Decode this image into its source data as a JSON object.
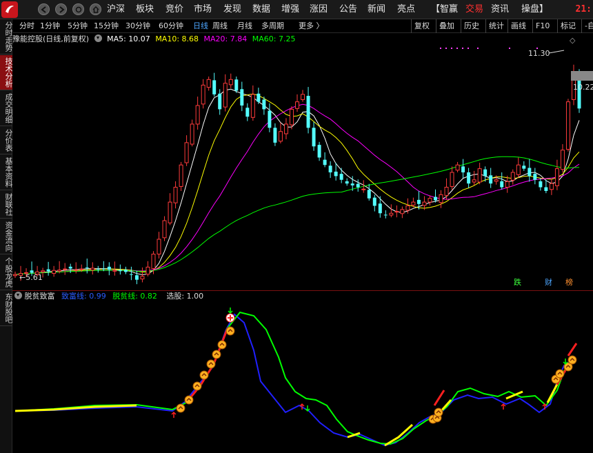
{
  "menu": {
    "items": [
      "沪深",
      "板块",
      "竞价",
      "市场",
      "发现",
      "数据",
      "增强",
      "涨因",
      "公告",
      "新闻",
      "亮点"
    ],
    "bracket_left": "【智赢",
    "trade": "交易",
    "news": "资讯",
    "operate": "操盘】",
    "clock": "21:"
  },
  "left_tabs": [
    "分时走势",
    "技术分析",
    "成交明细",
    "分价表",
    "基本资料",
    "财联社",
    "资金流向",
    "个股龙虎",
    "东财股吧"
  ],
  "left_tabs_active": 1,
  "periods": [
    "分时",
    "1分钟",
    "5分钟",
    "15分钟",
    "30分钟",
    "60分钟",
    "日线",
    "周线",
    "月线",
    "多周期",
    "更多 〉"
  ],
  "periods_active": 6,
  "tools": [
    "复权",
    "叠加",
    "历史",
    "统计",
    "画线",
    "F10",
    "标记",
    "-自"
  ],
  "chart_title": {
    "stock": "豫能控股(日线,前复权)",
    "ma5": "MA5: 10.07",
    "ma10": "MA10: 8.68",
    "ma20": "MA20: 7.84",
    "ma60": "MA60: 7.25"
  },
  "price_labels": {
    "high": "11.30",
    "current": "10.22",
    "low": "←5.61"
  },
  "badges": {
    "die": "跌",
    "cai": "财",
    "bang": "榜"
  },
  "sub_title": {
    "name": "脱贫致富",
    "line1": "致富线: 0.99",
    "line2": "脱贫线: 0.82",
    "pick": "选股: 1.00"
  },
  "colors": {
    "up": "#ff3b3b",
    "down": "#54ffff",
    "ma5": "#ffffff",
    "ma10": "#ffff00",
    "ma20": "#ff00ff",
    "ma60": "#00ff00",
    "sub_blue": "#2020ff",
    "sub_green": "#00ff00"
  },
  "chart_data": {
    "type": "candlestick",
    "series": [
      "MA5",
      "MA10",
      "MA20",
      "MA60"
    ],
    "closes": [
      5.75,
      5.78,
      5.8,
      5.8,
      5.82,
      5.85,
      5.84,
      5.86,
      5.87,
      5.9,
      5.91,
      5.88,
      5.9,
      5.93,
      5.92,
      5.89,
      5.9,
      5.88,
      5.86,
      5.84,
      5.82,
      5.75,
      5.61,
      5.7,
      5.95,
      6.3,
      6.7,
      7.2,
      7.7,
      8.1,
      8.7,
      9.3,
      9.8,
      10.3,
      10.85,
      11.0,
      10.6,
      10.2,
      10.9,
      11.0,
      10.7,
      10.3,
      10.0,
      10.6,
      10.4,
      10.2,
      9.7,
      9.3,
      9.6,
      9.8,
      10.2,
      10.4,
      10.6,
      9.7,
      9.2,
      8.9,
      8.7,
      8.5,
      8.4,
      8.3,
      8.2,
      8.15,
      8.1,
      8.05,
      7.8,
      7.6,
      7.4,
      7.35,
      7.4,
      7.45,
      7.5,
      7.6,
      7.7,
      7.65,
      7.7,
      7.8,
      7.75,
      7.9,
      8.1,
      8.5,
      8.7,
      8.5,
      8.2,
      8.3,
      8.6,
      8.4,
      8.2,
      8.3,
      8.1,
      8.25,
      8.5,
      8.7,
      8.6,
      8.4,
      8.3,
      8.1,
      8.0,
      8.2,
      8.6,
      9.1,
      10.4,
      11.2,
      10.22
    ]
  }
}
